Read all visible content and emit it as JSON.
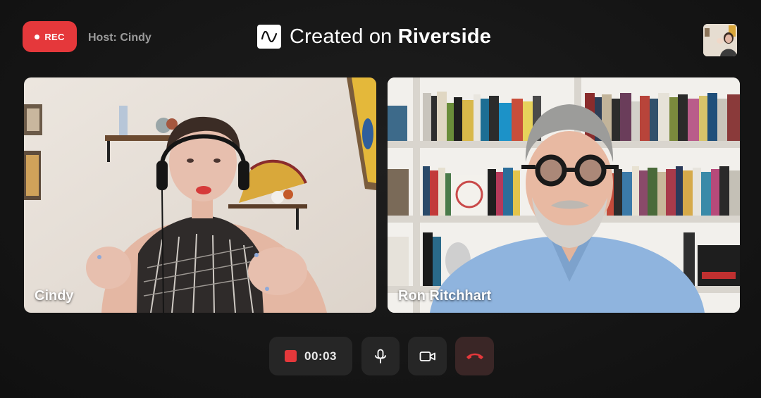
{
  "recording": {
    "badge_label": "REC",
    "host_label": "Host: Cindy"
  },
  "brand": {
    "prefix": "Created on ",
    "name": "Riverside"
  },
  "participants": [
    {
      "name": "Cindy"
    },
    {
      "name": "Ron Ritchhart"
    }
  ],
  "controls": {
    "timer": "00:03"
  },
  "colors": {
    "record_red": "#e5383b",
    "end_call_red": "#e5383b",
    "background": "#141414",
    "control_bg": "#262626"
  },
  "icons": {
    "logo": "waveform-icon",
    "record": "record-dot-icon",
    "stop": "stop-square-icon",
    "mic": "microphone-icon",
    "camera": "video-camera-icon",
    "end_call": "hang-up-phone-icon"
  }
}
